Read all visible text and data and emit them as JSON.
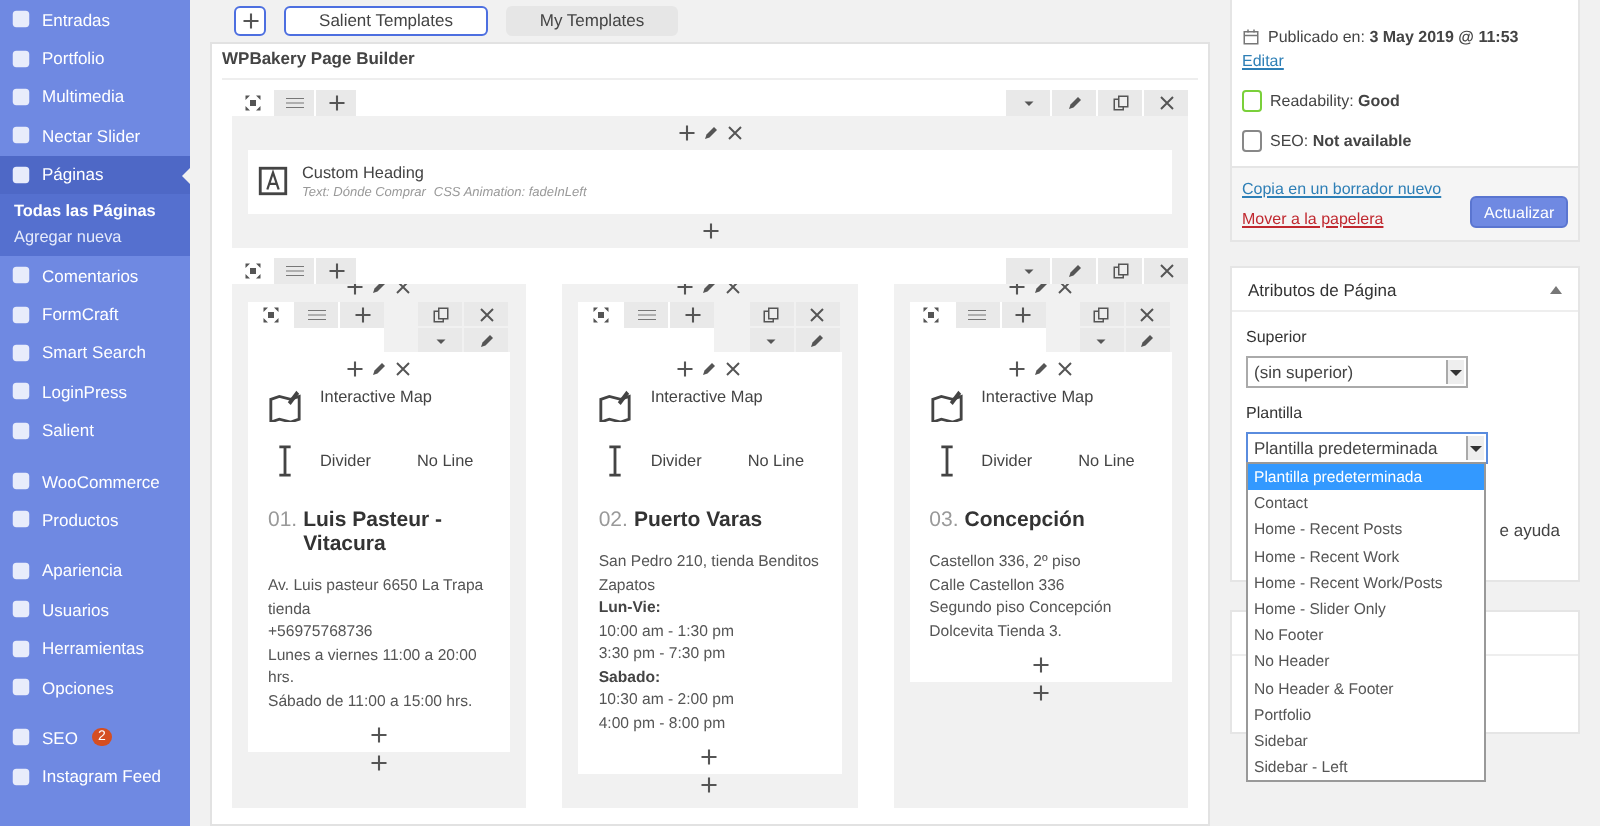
{
  "sidebar": {
    "groups": [
      {
        "items": [
          {
            "label": "Entradas",
            "selected": false
          },
          {
            "label": "Portfolio",
            "selected": false
          },
          {
            "label": "Multimedia",
            "selected": false
          },
          {
            "label": "Nectar Slider",
            "selected": false
          },
          {
            "label": "Páginas",
            "selected": true,
            "children": [
              {
                "label": "Todas las Páginas",
                "selected": true
              },
              {
                "label": "Agregar nueva",
                "selected": false
              }
            ]
          },
          {
            "label": "Comentarios",
            "selected": false
          },
          {
            "label": "FormCraft",
            "selected": false
          },
          {
            "label": "Smart Search",
            "selected": false
          },
          {
            "label": "LoginPress",
            "selected": false
          },
          {
            "label": "Salient",
            "selected": false
          }
        ]
      },
      {
        "items": [
          {
            "label": "WooCommerce",
            "selected": false
          },
          {
            "label": "Productos",
            "selected": false
          }
        ]
      },
      {
        "items": [
          {
            "label": "Apariencia",
            "selected": false
          },
          {
            "label": "Usuarios",
            "selected": false
          },
          {
            "label": "Herramientas",
            "selected": false
          },
          {
            "label": "Opciones",
            "selected": false
          }
        ]
      },
      {
        "items": [
          {
            "label": "SEO",
            "selected": false,
            "badge": "2"
          },
          {
            "label": "Instagram Feed",
            "selected": false
          }
        ]
      }
    ]
  },
  "toolbar": {
    "buttons": [
      {
        "label": "Salient Templates",
        "kind": "outlined"
      },
      {
        "label": "My Templates",
        "kind": "plain"
      }
    ]
  },
  "builder": {
    "title": "WPBakery Page Builder",
    "rows": [
      {
        "kind": "heading",
        "element": {
          "title": "Custom Heading",
          "params": [
            "Text: Dónde Comprar",
            "CSS Animation: fadeInLeft"
          ]
        }
      },
      {
        "kind": "columns",
        "columns": [
          {
            "map_label": "Interactive Map",
            "divider_label": "Divider",
            "divider_value": "No Line",
            "number": "01.",
            "name": "Luis Pasteur - Vitacura",
            "lines": [
              {
                "text": "Av. Luis pasteur 6650 La Trapa tienda",
                "bold": false
              },
              {
                "text": "+56975768736",
                "bold": false
              },
              {
                "text": "Lunes a viernes 11:00 a 20:00 hrs.",
                "bold": false
              },
              {
                "text": "Sábado de 11:00 a 15:00 hrs.",
                "bold": false
              }
            ]
          },
          {
            "map_label": "Interactive Map",
            "divider_label": "Divider",
            "divider_value": "No Line",
            "number": "02.",
            "name": "Puerto Varas",
            "lines": [
              {
                "text": "San Pedro 210, tienda Benditos Zapatos",
                "bold": false
              },
              {
                "text": "Lun-Vie:",
                "bold": true
              },
              {
                "text": "10:00 am - 1:30 pm",
                "bold": false
              },
              {
                "text": "3:30 pm - 7:30 pm",
                "bold": false
              },
              {
                "text": "Sabado:",
                "bold": true
              },
              {
                "text": "10:30 am - 2:00 pm",
                "bold": false
              },
              {
                "text": "4:00 pm - 8:00 pm",
                "bold": false
              }
            ]
          },
          {
            "map_label": "Interactive Map",
            "divider_label": "Divider",
            "divider_value": "No Line",
            "number": "03.",
            "name": "Concepción",
            "lines": [
              {
                "text": "Castellon 336, 2º piso",
                "bold": false
              },
              {
                "text": "Calle Castellon 336",
                "bold": false
              },
              {
                "text": "Segundo piso Concepción",
                "bold": false
              },
              {
                "text": "Dolcevita Tienda 3.",
                "bold": false
              }
            ]
          }
        ]
      }
    ]
  },
  "publish": {
    "published": "Publicado en: **3 May 2019 @ 11:53**",
    "edit_link": "Editar",
    "scores": [
      {
        "text": "Readability: **Good**",
        "color": "#7ad03a"
      },
      {
        "text": "SEO: **Not available**",
        "color": "#888888"
      }
    ],
    "copy_link": "Copia en un borrador nuevo",
    "trash_link": "Mover a la papelera",
    "update_button": "Actualizar"
  },
  "page_attributes": {
    "title": "Atributos de Página",
    "expanded": true,
    "parent_label": "Superior",
    "parent_value": "(sin superior)",
    "template_label": "Plantilla",
    "template_value": "Plantilla predeterminada",
    "template_open": true,
    "template_options": [
      {
        "label": "Plantilla predeterminada",
        "selected": true
      },
      {
        "label": "Contact",
        "selected": false
      },
      {
        "label": "Home - Recent Posts",
        "selected": false
      },
      {
        "label": "Home - Recent Work",
        "selected": false
      },
      {
        "label": "Home - Recent Work/Posts",
        "selected": false
      },
      {
        "label": "Home - Slider Only",
        "selected": false
      },
      {
        "label": "No Footer",
        "selected": false
      },
      {
        "label": "No Header",
        "selected": false
      },
      {
        "label": "No Header & Footer",
        "selected": false
      },
      {
        "label": "Portfolio",
        "selected": false
      },
      {
        "label": "Sidebar",
        "selected": false
      },
      {
        "label": "Sidebar - Left",
        "selected": false
      }
    ],
    "help_fragment": "e ayuda"
  }
}
